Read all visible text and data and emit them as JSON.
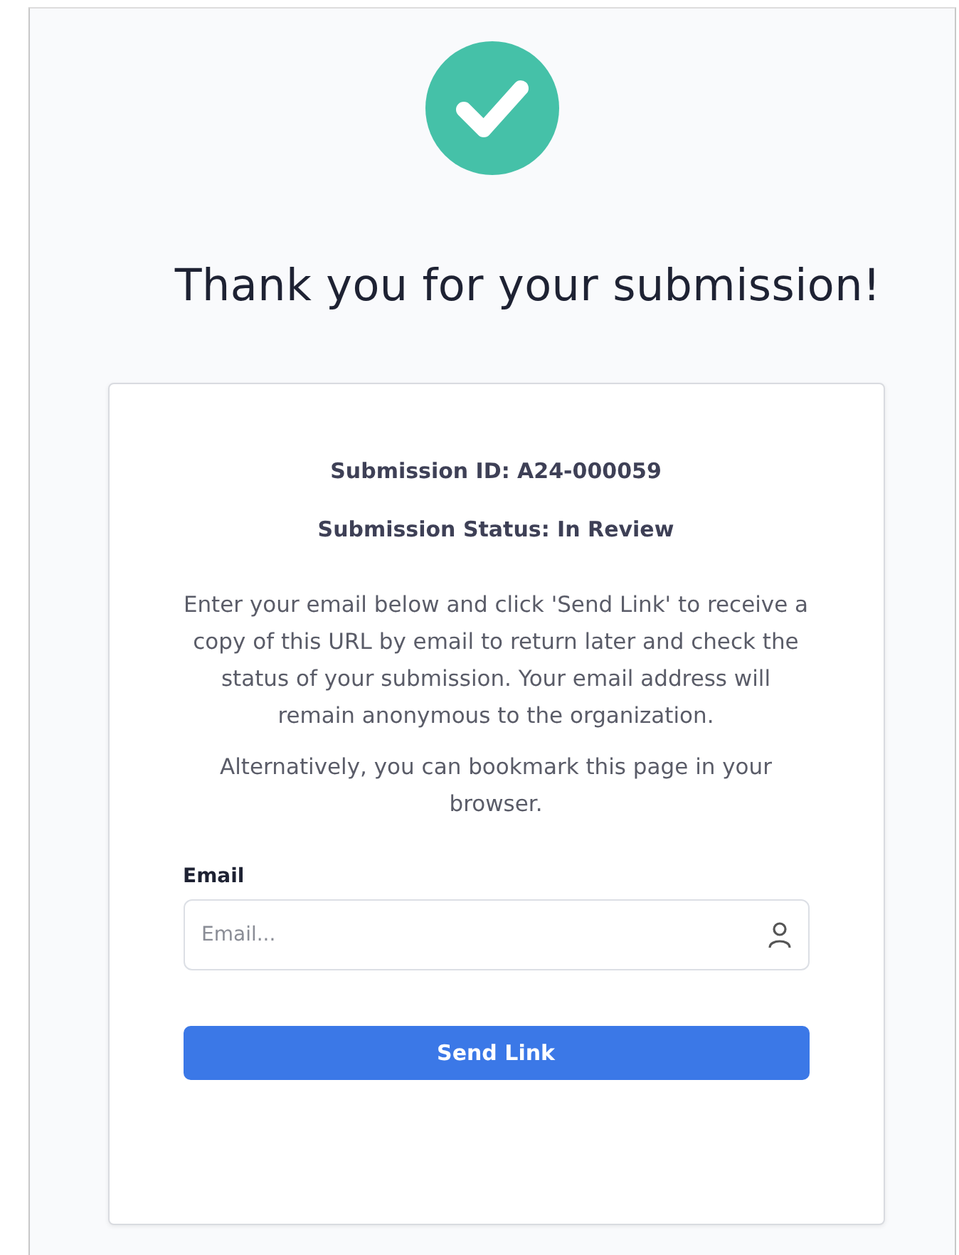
{
  "title": "Thank you for your submission!",
  "details": [
    "Submission ID: A24-000059",
    "Submission Status: In Review"
  ],
  "paragraphs": [
    "Enter your email below and click 'Send Link' to receive a copy of this URL by email to return later and check the status of your submission. Your email address will remain anonymous to the organization.",
    "Alternatively, you can bookmark this page in your browser."
  ],
  "email": {
    "label": "Email",
    "placeholder": "Email..."
  },
  "button": "Send Link"
}
